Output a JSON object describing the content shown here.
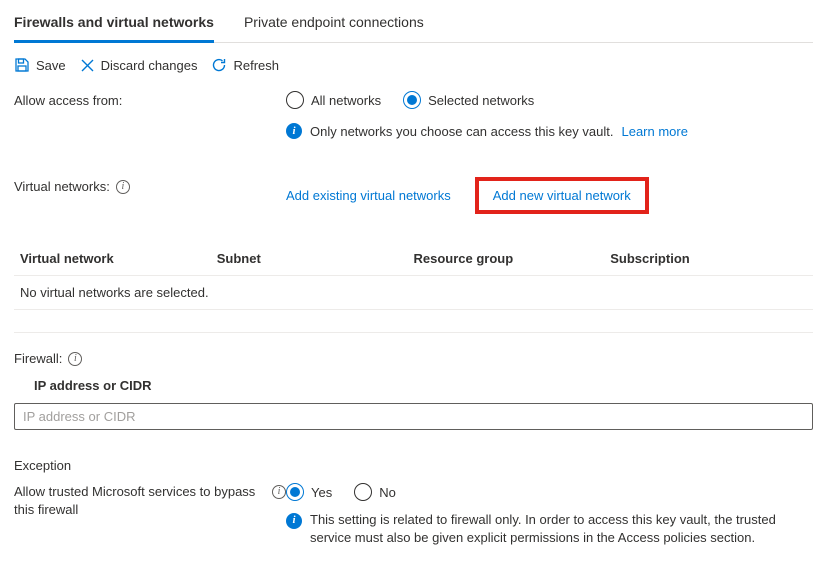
{
  "tabs": {
    "firewalls": "Firewalls and virtual networks",
    "endpoints": "Private endpoint connections"
  },
  "toolbar": {
    "save": "Save",
    "discard": "Discard changes",
    "refresh": "Refresh"
  },
  "access": {
    "label": "Allow access from:",
    "option_all": "All networks",
    "option_selected": "Selected networks",
    "info_text": "Only networks you choose can access this key vault.",
    "learn_more": "Learn more"
  },
  "vnets": {
    "label": "Virtual networks:",
    "add_existing": "Add existing virtual networks",
    "add_new": "Add new virtual network",
    "headers": {
      "vnet": "Virtual network",
      "subnet": "Subnet",
      "rg": "Resource group",
      "sub": "Subscription"
    },
    "empty_row": "No virtual networks are selected."
  },
  "firewall": {
    "label": "Firewall:",
    "column": "IP address or CIDR",
    "placeholder": "IP address or CIDR"
  },
  "exception": {
    "title": "Exception",
    "label": "Allow trusted Microsoft services to bypass this firewall",
    "yes": "Yes",
    "no": "No",
    "info": "This setting is related to firewall only. In order to access this key vault, the trusted service must also be given explicit permissions in the Access policies section."
  }
}
